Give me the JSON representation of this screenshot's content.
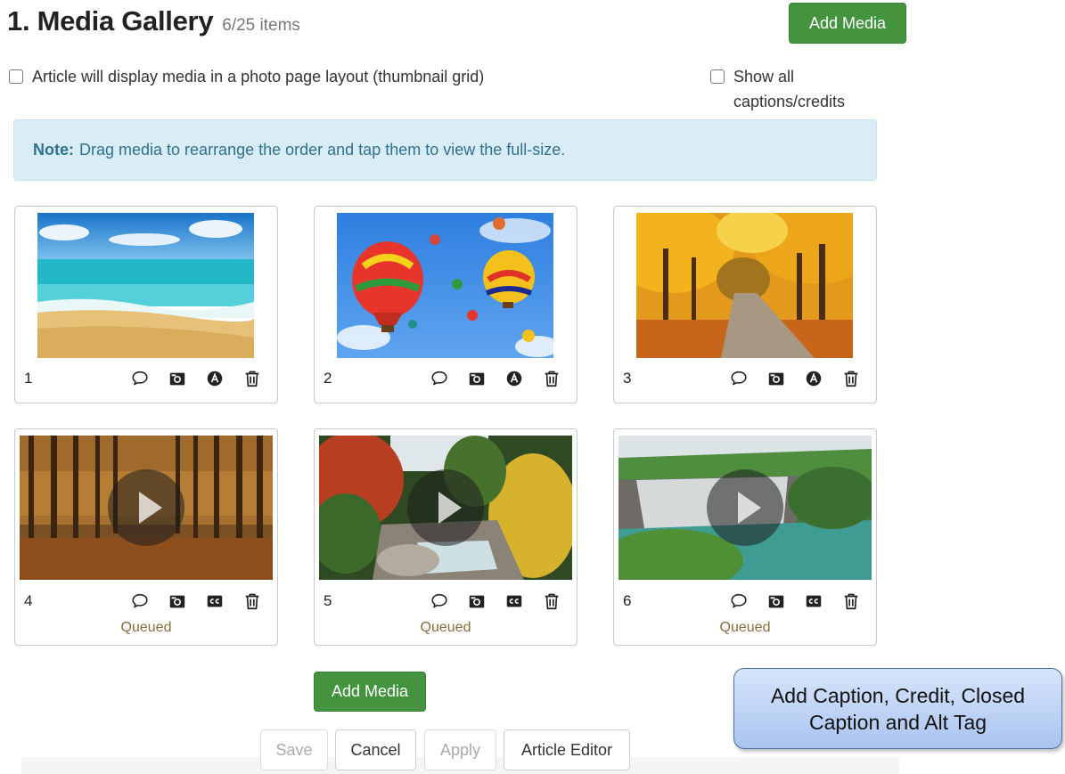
{
  "header": {
    "title": "1. Media Gallery",
    "count": "6/25 items"
  },
  "buttons": {
    "add_media": "Add Media",
    "save": "Save",
    "cancel": "Cancel",
    "apply": "Apply",
    "article_editor": "Article Editor"
  },
  "options": {
    "photo_layout": "Article will display media in a photo page layout (thumbnail grid)",
    "show_captions": "Show all captions/credits"
  },
  "note": {
    "label": "Note:",
    "text": "Drag media to rearrange the order and tap them to view the full-size."
  },
  "media": [
    {
      "number": "1",
      "kind": "photo",
      "status": ""
    },
    {
      "number": "2",
      "kind": "photo",
      "status": ""
    },
    {
      "number": "3",
      "kind": "photo",
      "status": ""
    },
    {
      "number": "4",
      "kind": "video",
      "status": "Queued"
    },
    {
      "number": "5",
      "kind": "video",
      "status": "Queued"
    },
    {
      "number": "6",
      "kind": "video",
      "status": "Queued"
    }
  ],
  "icons": {
    "caption": "speech-bubble-icon",
    "credit": "camera-icon",
    "alt_tag": "alt-tag-icon",
    "closed_caption": "cc-icon",
    "delete": "trash-icon"
  },
  "callout": {
    "text": "Add Caption, Credit, Closed Caption and Alt Tag"
  },
  "colors": {
    "primary_green": "#43933f",
    "note_bg": "#d9edf7",
    "note_text": "#31708f",
    "status_text": "#8a6d3b"
  }
}
